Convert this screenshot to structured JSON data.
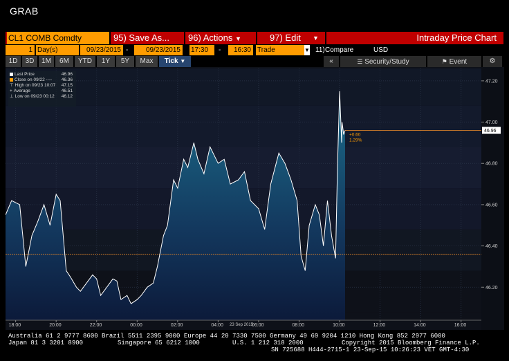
{
  "window_title": "GRAB",
  "toolbar": {
    "security": "CL1 COMB Comdty",
    "save_num": "95)",
    "save_label": "Save As...",
    "actions_num": "96)",
    "actions_label": "Actions",
    "edit_num": "97)",
    "edit_label": "Edit",
    "chart_title": "Intraday Price Chart"
  },
  "params": {
    "period_count": "1",
    "period_unit": "Day(s)",
    "start_date": "09/23/2015",
    "end_date": "09/23/2015",
    "start_time": "17:30",
    "end_time": "16:30",
    "dash": "-",
    "field": "Trade",
    "compare_num": "11)",
    "compare_label": "Compare",
    "currency": "USD"
  },
  "range_tabs": [
    "1D",
    "3D",
    "1M",
    "6M",
    "YTD",
    "1Y",
    "5Y",
    "Max"
  ],
  "tick_tab": "Tick",
  "right_controls": {
    "collapse": "«",
    "security_study": "Security/Study",
    "event": "Event"
  },
  "legend": {
    "last_price_label": "Last Price",
    "last_price_value": "46.96",
    "close_label": "Close on 09/22 ----",
    "close_value": "46.36",
    "high_label": "High on 09/23 10:07",
    "high_value": "47.15",
    "average_label": "Average",
    "average_value": "46.51",
    "low_label": "Low on 09/23 00:12",
    "low_value": "46.12"
  },
  "chart_data": {
    "type": "area",
    "title": "",
    "xlabel": "",
    "ylabel": "",
    "x_date_label": "23 Sep 2015",
    "x_ticks": [
      "18:00",
      "20:00",
      "22:00",
      "00:00",
      "02:00",
      "04:00",
      "06:00",
      "08:00",
      "10:00",
      "12:00",
      "14:00",
      "16:00"
    ],
    "y_ticks": [
      "46.20",
      "46.40",
      "46.60",
      "46.80",
      "47.00",
      "47.20"
    ],
    "ylim": [
      46.04,
      47.26
    ],
    "xlim_hours": [
      -6.5,
      17.0
    ],
    "last_price_tag": "46.96",
    "change": "+0.60",
    "change_pct": "1.29%",
    "prev_close": 46.36,
    "series": [
      {
        "x": [
          -6.5,
          -6.2,
          -5.8,
          -5.5,
          -5.2,
          -4.9,
          -4.6,
          -4.3,
          -4.0,
          -3.8,
          -3.5,
          -3.3,
          -3.0,
          -2.8,
          -2.5,
          -2.2,
          -2.0,
          -1.8,
          -1.5,
          -1.2,
          -1.0,
          -0.8,
          -0.5,
          -0.3,
          0.0,
          0.2,
          0.5,
          0.8,
          1.0,
          1.3,
          1.5,
          1.8,
          2.0,
          2.3,
          2.5,
          2.8,
          3.0,
          3.3,
          3.6,
          4.0,
          4.3,
          4.6,
          5.0,
          5.3,
          5.6,
          6.0,
          6.3,
          6.6,
          7.0,
          7.3,
          7.6,
          7.9,
          8.1,
          8.3,
          8.5,
          8.8,
          9.0,
          9.2,
          9.4,
          9.6,
          9.8,
          9.9,
          10.0,
          10.1,
          10.12,
          10.2,
          10.27
        ],
        "y": [
          46.55,
          46.62,
          46.6,
          46.3,
          46.45,
          46.52,
          46.6,
          46.5,
          46.65,
          46.62,
          46.28,
          46.25,
          46.2,
          46.18,
          46.22,
          46.26,
          46.24,
          46.16,
          46.2,
          46.24,
          46.23,
          46.14,
          46.16,
          46.12,
          46.14,
          46.16,
          46.2,
          46.22,
          46.3,
          46.45,
          46.5,
          46.72,
          46.68,
          46.82,
          46.78,
          46.9,
          46.82,
          46.75,
          46.88,
          46.8,
          46.82,
          46.7,
          46.72,
          46.76,
          46.62,
          46.58,
          46.48,
          46.7,
          46.85,
          46.8,
          46.72,
          46.62,
          46.35,
          46.28,
          46.5,
          46.6,
          46.55,
          46.4,
          46.62,
          46.45,
          46.34,
          46.8,
          47.15,
          46.9,
          47.0,
          46.94,
          46.96
        ]
      }
    ]
  },
  "footer": {
    "line1": "Australia 61 2 9777 8600 Brazil 5511 2395 9000 Europe 44 20 7330 7500 Germany 49 69 9204 1210 Hong Kong 852 2977 6000",
    "line2a": "Japan 81 3 3201 8900",
    "line2b": "Singapore 65 6212 1000",
    "line2c": "U.S. 1 212 318 2000",
    "line2d": "Copyright 2015 Bloomberg Finance L.P.",
    "line3": "SN 725688 H444-2715-1 23-Sep-15 10:26:23 VET  GMT-4:30"
  },
  "colors": {
    "accent_orange": "#ff9c00",
    "toolbar_red": "#c00000",
    "line_white": "#ffffff",
    "prev_close_line": "#c8782a"
  }
}
